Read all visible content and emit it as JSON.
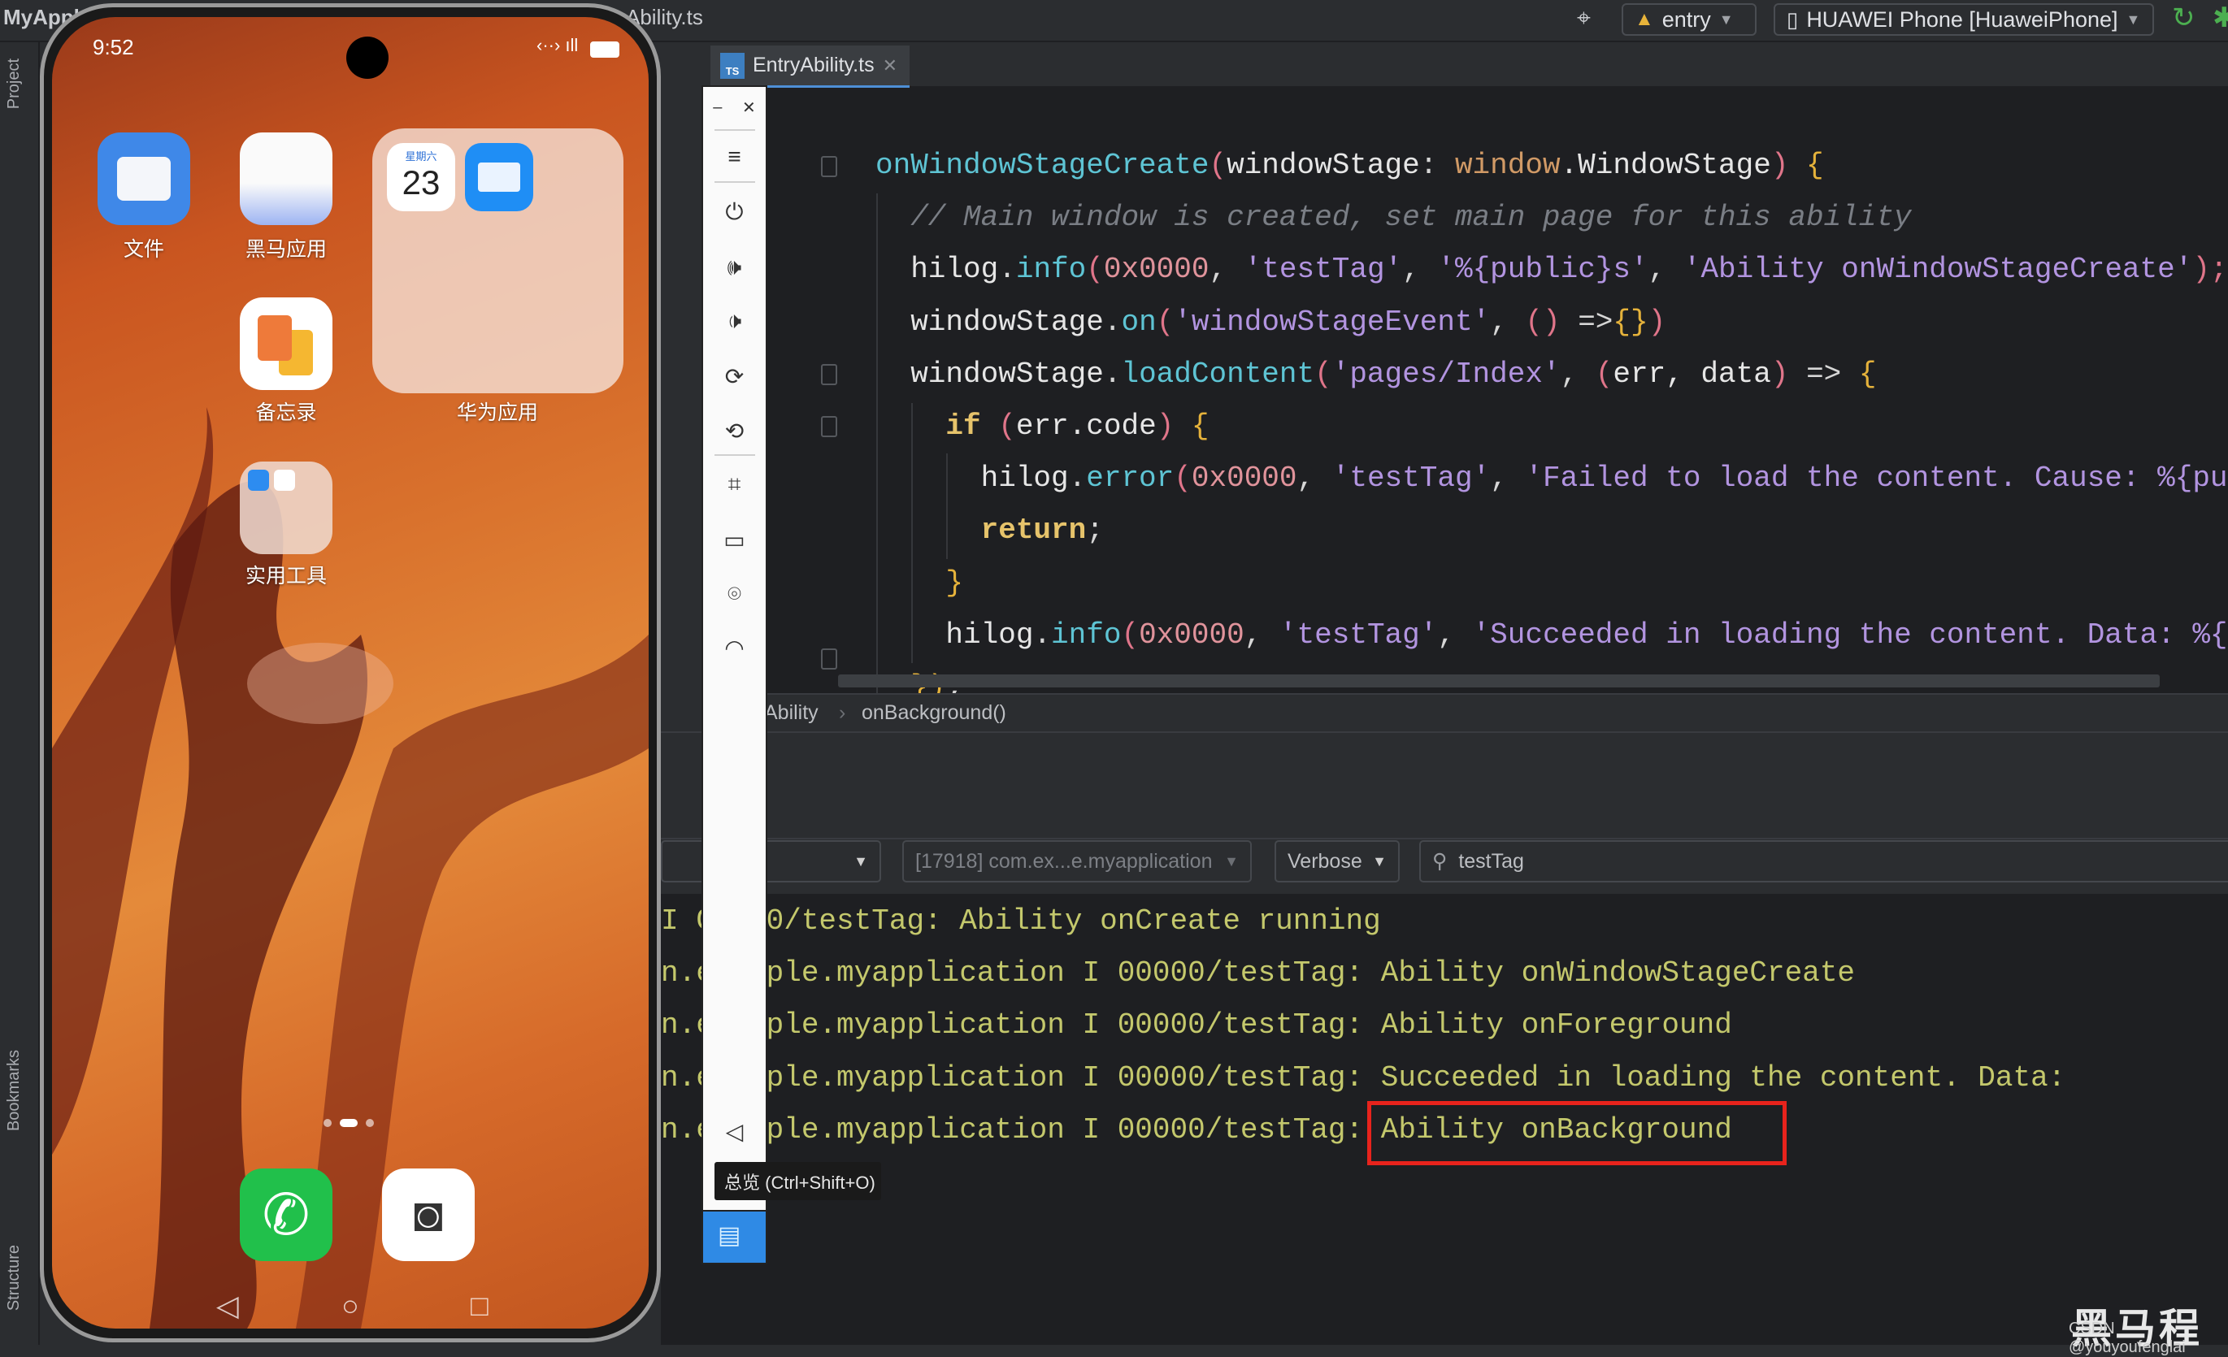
{
  "titlebar": {
    "project": "MyAppl",
    "file_fragment": "Ability.ts",
    "module": "entry",
    "device": "HUAWEI Phone [HuaweiPhone]"
  },
  "sidebar": {
    "project": "Project",
    "bookmarks": "Bookmarks",
    "structure": "Structure"
  },
  "editor": {
    "tab": {
      "label": "EntryAbility.ts",
      "icon_text": "TS"
    },
    "lines": [
      [
        [
          "onWindowStageCreate",
          "fn"
        ],
        [
          "(",
          "pa"
        ],
        [
          "windowStage",
          "id"
        ],
        [
          ": ",
          "pu"
        ],
        [
          "window",
          "ty"
        ],
        [
          ".WindowStage",
          "id"
        ],
        [
          ") ",
          "pa"
        ],
        [
          "{",
          "br"
        ]
      ],
      [
        [
          "  // Main window is created, set main page for this ability",
          "cm"
        ]
      ],
      [
        [
          "  hilog",
          "id"
        ],
        [
          ".",
          "pu"
        ],
        [
          "info",
          "fn"
        ],
        [
          "(",
          "pa"
        ],
        [
          "0x0000",
          "nu"
        ],
        [
          ", ",
          "pu"
        ],
        [
          "'testTag'",
          "st"
        ],
        [
          ", ",
          "pu"
        ],
        [
          "'%{public}s'",
          "st"
        ],
        [
          ", ",
          "pu"
        ],
        [
          "'Ability onWindowStageCreate'",
          "st"
        ],
        [
          ");",
          "pa"
        ]
      ],
      [
        [
          "  windowStage",
          "id"
        ],
        [
          ".",
          "pu"
        ],
        [
          "on",
          "fn"
        ],
        [
          "(",
          "pa"
        ],
        [
          "'windowStageEvent'",
          "st"
        ],
        [
          ", ",
          "pu"
        ],
        [
          "() ",
          "pa"
        ],
        [
          "=>",
          "pu"
        ],
        [
          "{}",
          "br"
        ],
        [
          ")",
          "pa"
        ]
      ],
      [
        [
          "  windowStage",
          "id"
        ],
        [
          ".",
          "pu"
        ],
        [
          "loadContent",
          "fn"
        ],
        [
          "(",
          "pa"
        ],
        [
          "'pages/Index'",
          "st"
        ],
        [
          ", ",
          "pu"
        ],
        [
          "(",
          "pa"
        ],
        [
          "err, data",
          "id"
        ],
        [
          ") ",
          "pa"
        ],
        [
          "=> ",
          "pu"
        ],
        [
          "{",
          "br"
        ]
      ],
      [
        [
          "    ",
          "id"
        ],
        [
          "if",
          "kw"
        ],
        [
          " (",
          "pa"
        ],
        [
          "err.code",
          "id"
        ],
        [
          ") ",
          "pa"
        ],
        [
          "{",
          "br"
        ]
      ],
      [
        [
          "      hilog",
          "id"
        ],
        [
          ".",
          "pu"
        ],
        [
          "error",
          "fn"
        ],
        [
          "(",
          "pa"
        ],
        [
          "0x0000",
          "nu"
        ],
        [
          ", ",
          "pu"
        ],
        [
          "'testTag'",
          "st"
        ],
        [
          ", ",
          "pu"
        ],
        [
          "'Failed to load the content. Cause: %{pu",
          "st"
        ]
      ],
      [
        [
          "      ",
          "id"
        ],
        [
          "return",
          "kw"
        ],
        [
          ";",
          "pu"
        ]
      ],
      [
        [
          "    }",
          "br"
        ]
      ],
      [
        [
          "    hilog",
          "id"
        ],
        [
          ".",
          "pu"
        ],
        [
          "info",
          "fn"
        ],
        [
          "(",
          "pa"
        ],
        [
          "0x0000",
          "nu"
        ],
        [
          ", ",
          "pu"
        ],
        [
          "'testTag'",
          "st"
        ],
        [
          ", ",
          "pu"
        ],
        [
          "'Succeeded in loading the content. Data: %{",
          "st"
        ]
      ],
      [
        [
          "  })",
          "br"
        ],
        [
          ";",
          "pu"
        ]
      ]
    ],
    "breadcrumb": [
      "Ability",
      "onBackground()"
    ]
  },
  "log": {
    "filter_process": "[17918] com.ex...e.myapplication",
    "level": "Verbose",
    "search": "testTag",
    "lines": [
      "I C0000/testTag: Ability onCreate running",
      "n.example.myapplication I 00000/testTag: Ability onWindowStageCreate",
      "n.example.myapplication I 00000/testTag: Ability onForeground",
      "n.example.myapplication I 00000/testTag: Succeeded in loading the content. Data:",
      "n.example.myapplication I 00000/testTag: Ability onBackground"
    ],
    "highlight_color": "#e8231c"
  },
  "emulator": {
    "tooltip": "总览 (Ctrl+Shift+O)"
  },
  "phone": {
    "time": "9:52",
    "apps": [
      {
        "label": "文件"
      },
      {
        "label": "黑马应用"
      },
      {
        "label": "备忘录"
      },
      {
        "label": "实用工具"
      }
    ],
    "folder_label": "华为应用",
    "calendar": {
      "weekday": "星期六",
      "day": "23"
    }
  },
  "watermark": {
    "main": "黑马程",
    "sub": "CSDN @youyoufenglai"
  }
}
